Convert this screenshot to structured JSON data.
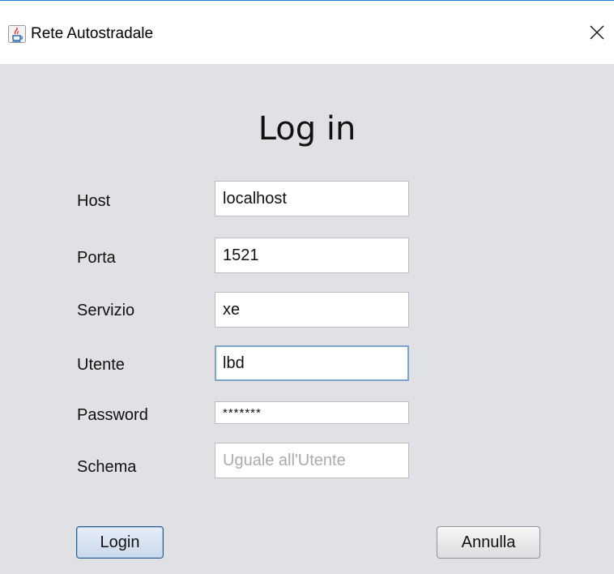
{
  "window": {
    "title": "Rete Autostradale",
    "close_glyph": "✕",
    "app_icon": "java-cup-icon"
  },
  "login": {
    "heading": "Log in",
    "fields": {
      "host": {
        "label": "Host",
        "value": "localhost"
      },
      "porta": {
        "label": "Porta",
        "value": "1521"
      },
      "servizio": {
        "label": "Servizio",
        "value": "xe"
      },
      "utente": {
        "label": "Utente",
        "value": "lbd",
        "focused": true
      },
      "password": {
        "label": "Password",
        "value": "*******"
      },
      "schema": {
        "label": "Schema",
        "value": "",
        "placeholder": "Uguale all'Utente"
      }
    },
    "buttons": {
      "login": "Login",
      "cancel": "Annulla"
    }
  },
  "colors": {
    "content_background": "#dfe1e5",
    "focus_border": "#7ca3c9",
    "titlebar_accent": "#1883d7"
  }
}
